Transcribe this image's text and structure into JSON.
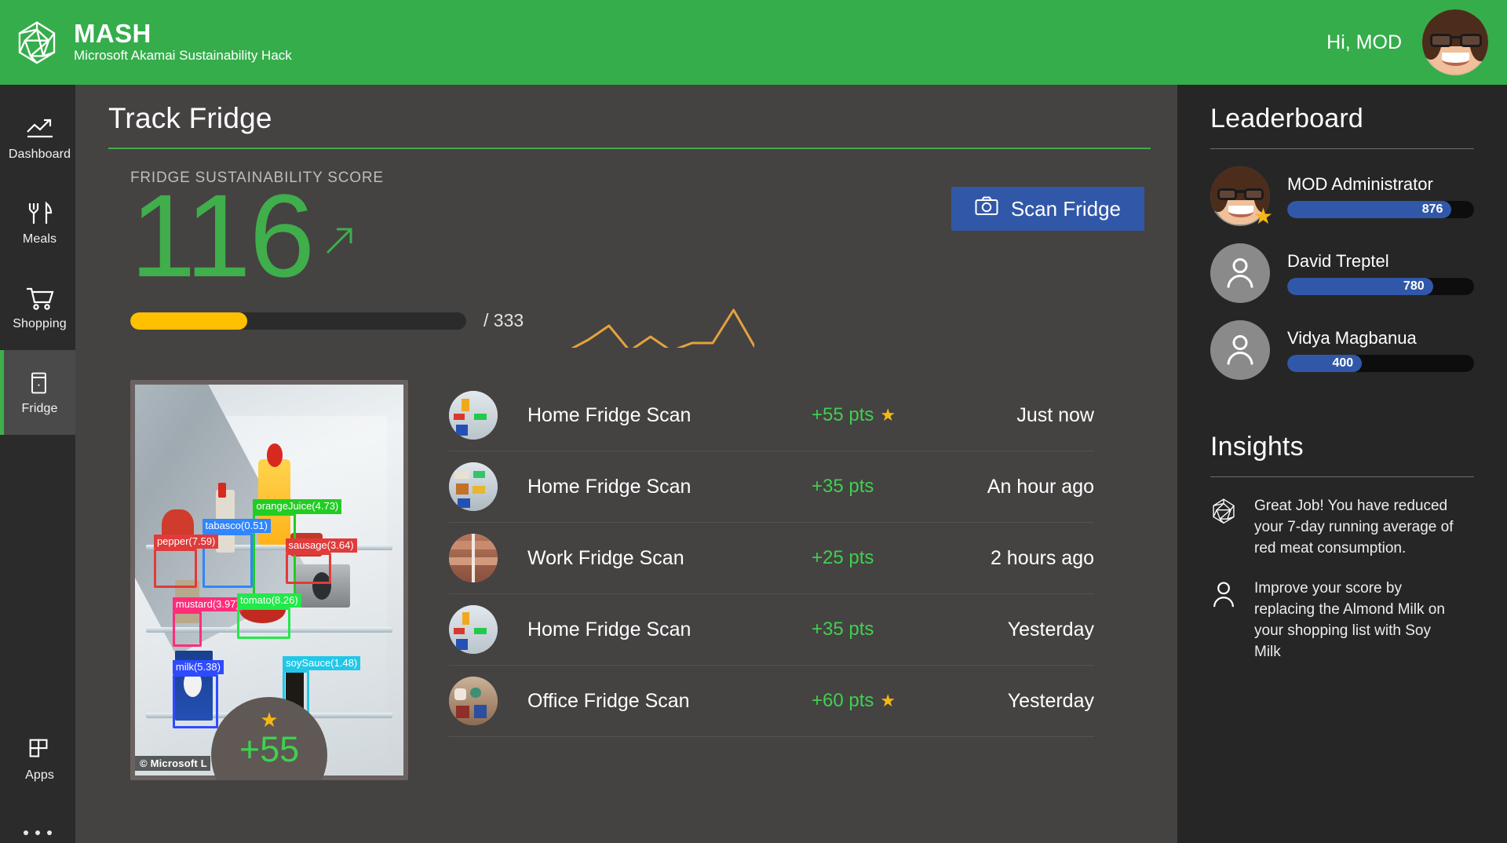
{
  "header": {
    "brand_title": "MASH",
    "brand_subtitle": "Microsoft Akamai Sustainability Hack",
    "greeting": "Hi, MOD",
    "logo_icon": "icosahedron-logo-icon",
    "avatar_icon": "user-avatar-photo"
  },
  "sidebar": {
    "items": [
      {
        "label": "Dashboard",
        "icon": "trending-up-icon",
        "active": false
      },
      {
        "label": "Meals",
        "icon": "fork-knife-icon",
        "active": false
      },
      {
        "label": "Shopping",
        "icon": "shopping-cart-icon",
        "active": false
      },
      {
        "label": "Fridge",
        "icon": "fridge-icon",
        "active": true
      }
    ],
    "bottom": {
      "label": "Apps",
      "icon": "apps-grid-icon"
    },
    "overflow_icon": "ellipsis-icon"
  },
  "main": {
    "page_title": "Track Fridge",
    "score_caption": "FRIDGE SUSTAINABILITY SCORE",
    "score_value": "116",
    "score_total": "/ 333",
    "trend_icon": "arrow-up-right-icon",
    "scan_button": {
      "label": "Scan Fridge",
      "icon": "camera-icon"
    },
    "progress": {
      "value": 116,
      "max": 333,
      "percent": 34.8,
      "color": "#ffc000"
    },
    "sparkline": {
      "color": "#e5a33c",
      "points": [
        62,
        48,
        30,
        62,
        44,
        62,
        52,
        52,
        10,
        56
      ]
    },
    "scan_photo": {
      "points_badge": "+55",
      "star_icon": "star-icon",
      "watermark": "© Microsoft L",
      "detections": [
        {
          "label": "orangeJuice(4.73)",
          "color": "#22cc22"
        },
        {
          "label": "tabasco(0.51)",
          "color": "#2f86ff"
        },
        {
          "label": "pepper(7.59)",
          "color": "#e03b3b"
        },
        {
          "label": "sausage(3.64)",
          "color": "#e03b3b"
        },
        {
          "label": "mustard(3.97)",
          "color": "#ff2d7a"
        },
        {
          "label": "tomato(8.26)",
          "color": "#22e84a"
        },
        {
          "label": "milk(5.38)",
          "color": "#2f4bff"
        },
        {
          "label": "soySauce(1.48)",
          "color": "#22c7e8"
        }
      ]
    },
    "activity": [
      {
        "name": "Home Fridge Scan",
        "points": "+55 pts",
        "starred": true,
        "time": "Just now"
      },
      {
        "name": "Home Fridge Scan",
        "points": "+35 pts",
        "starred": false,
        "time": "An hour ago"
      },
      {
        "name": "Work Fridge Scan",
        "points": "+25 pts",
        "starred": false,
        "time": "2 hours ago"
      },
      {
        "name": "Home Fridge Scan",
        "points": "+35 pts",
        "starred": false,
        "time": "Yesterday"
      },
      {
        "name": "Office Fridge Scan",
        "points": "+60 pts",
        "starred": true,
        "time": "Yesterday"
      }
    ]
  },
  "leaderboard": {
    "title": "Leaderboard",
    "entries": [
      {
        "name": "MOD Administrator",
        "score": "876",
        "percent": 88,
        "leader": true,
        "avatar": "user-photo-avatar"
      },
      {
        "name": "David Treptel",
        "score": "780",
        "percent": 78,
        "leader": false,
        "avatar": "person-placeholder-icon"
      },
      {
        "name": "Vidya Magbanua",
        "score": "400",
        "percent": 40,
        "leader": false,
        "avatar": "person-placeholder-icon"
      }
    ]
  },
  "insights": {
    "title": "Insights",
    "items": [
      {
        "icon": "icosahedron-logo-icon",
        "text": "Great Job! You have reduced your 7-day running average of red meat consumption."
      },
      {
        "icon": "person-icon",
        "text": "Improve your score by replacing the Almond Milk on your shopping list with Soy Milk"
      }
    ]
  },
  "colors": {
    "brand_green": "#35ad4b",
    "accent_green": "#3fae4b",
    "points_green": "#3fd04f",
    "amber": "#ffc000",
    "blue": "#3158a8",
    "star_gold": "#f5b812",
    "main_bg": "#454242",
    "panel_bg": "#262626",
    "nav_bg": "#2b2b2b"
  }
}
